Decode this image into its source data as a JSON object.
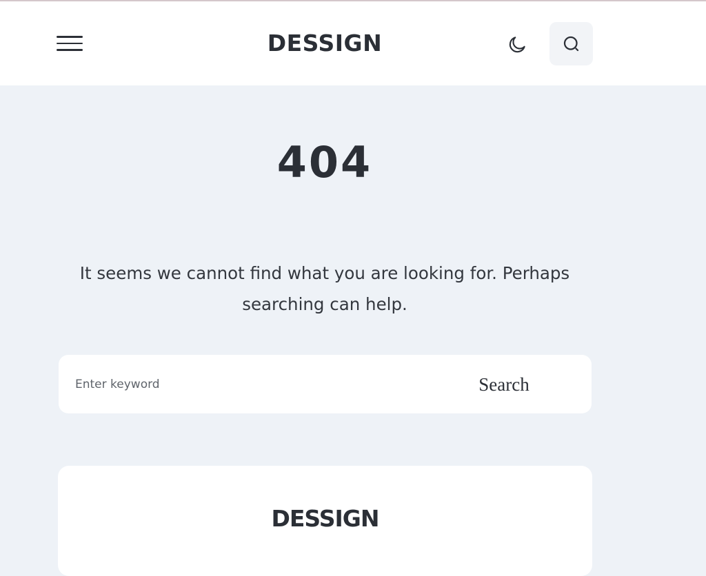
{
  "header": {
    "site_title": "DESSIGN",
    "menu_icon": "hamburger-menu-icon",
    "theme_icon": "moon-icon",
    "search_icon": "search-icon"
  },
  "error": {
    "code": "404",
    "message": "It seems we cannot find what you are looking for. Perhaps searching can help."
  },
  "search": {
    "placeholder": "Enter keyword",
    "value": "",
    "submit_label": "Search"
  },
  "footer": {
    "logo_text": "DESSIGN"
  },
  "colors": {
    "page_background": "#eef2f7",
    "surface": "#ffffff",
    "text": "#2b2f36",
    "search_button_bg": "#f2f4f7"
  }
}
